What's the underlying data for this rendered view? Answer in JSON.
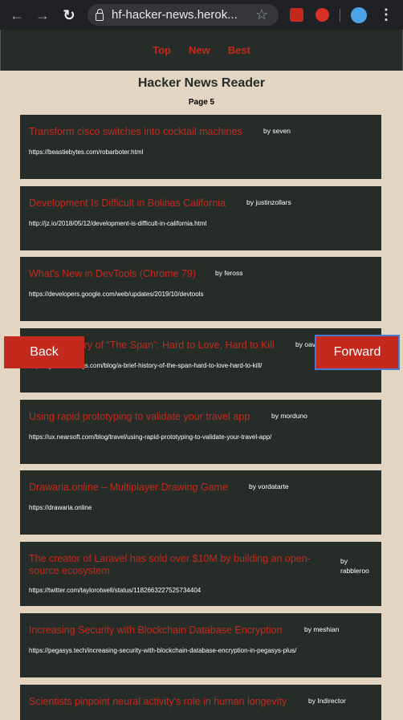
{
  "browser": {
    "url": "hf-hacker-news.herok...",
    "back_icon": "←",
    "forward_icon": "→",
    "reload_icon": "↻",
    "star_icon": "☆",
    "menu_icon": "⋮"
  },
  "nav": {
    "top": "Top",
    "new": "New",
    "best": "Best"
  },
  "header": {
    "title": "Hacker News Reader",
    "page": "Page 5"
  },
  "stories": [
    {
      "title": "Transform cisco switches into cocktail machines",
      "author": "by seven",
      "url": "https://beastiebytes.com/robarboter.html"
    },
    {
      "title": "Development Is Difficult in Bolinas California",
      "author": "by justinzollars",
      "url": "http://jz.io/2018/05/12/development-is-difficult-in-california.html"
    },
    {
      "title": "What's New in DevTools (Chrome 79)",
      "author": "by feross",
      "url": "https://developers.google.com/web/updates/2019/10/devtools"
    },
    {
      "title": "A Brief History of “The Span”: Hard to Love, Hard to Kill",
      "author": "by oav",
      "url": "https://gomakethings.com/blog/a-brief-history-of-the-span-hard-to-love-hard-to-kill/"
    },
    {
      "title": "Using rapid prototyping to validate your travel app",
      "author": "by morduno",
      "url": "https://ux.nearsoft.com/blog/travel/using-rapid-prototyping-to-validate-your-travel-app/"
    },
    {
      "title": "Drawaria.online – Multiplayer Drawing Game",
      "author": "by vordatarte",
      "url": "https://drawaria.online"
    },
    {
      "title": "The creator of Laravel has sold over $10M by building an open-source ecosystem",
      "author": "by rabbleroo",
      "url": "https://twitter.com/taylorotwell/status/1182663227525734404"
    },
    {
      "title": "Increasing Security with Blockchain Database Encryption",
      "author": "by meshian",
      "url": "https://pegasys.tech/increasing-security-with-blockchain-database-encryption-in-pegasys-plus/"
    },
    {
      "title": "Scientists pinpoint neural activity's role in human longevity",
      "author": "by Indirector",
      "url": ""
    }
  ],
  "buttons": {
    "back": "Back",
    "forward": "Forward"
  },
  "colors": {
    "accent": "#c4291d",
    "card_bg": "#262d29",
    "page_bg": "#e2d5c2"
  }
}
